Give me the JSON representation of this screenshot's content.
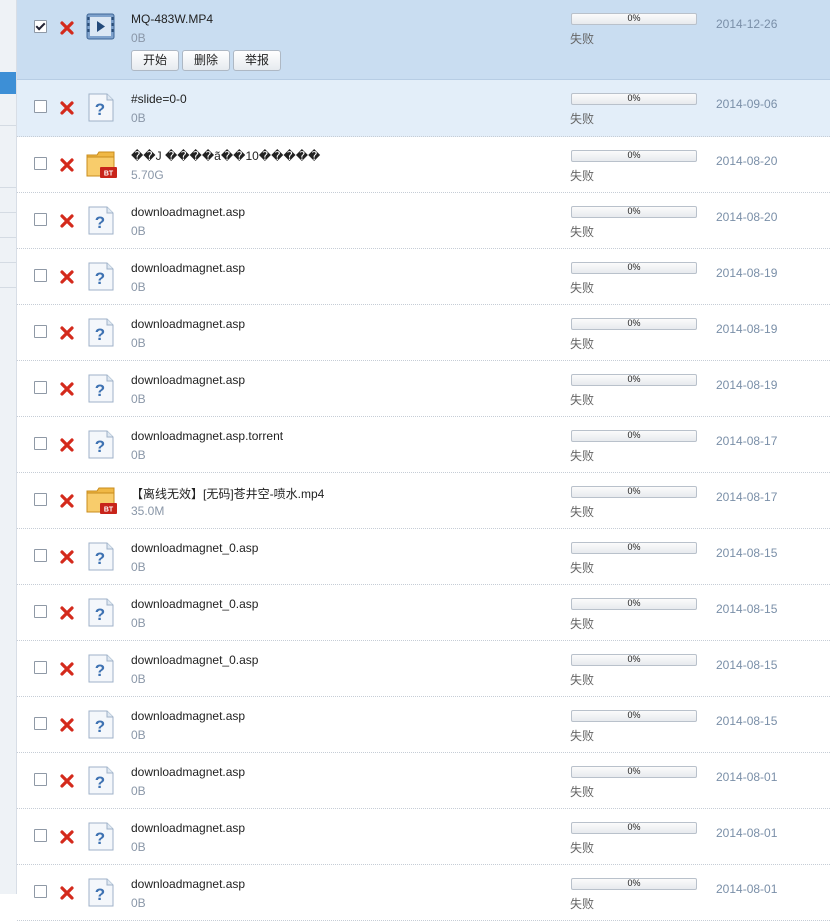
{
  "actions": {
    "start": "开始",
    "delete": "删除",
    "report": "举报"
  },
  "colors": {
    "progress_fill": "#6db33f",
    "selected_row": "#c9ddf1",
    "date_text": "#7a8fa8"
  },
  "rows": [
    {
      "name": "MQ-483W.MP4",
      "size": "0B",
      "progress": "0%",
      "status": "失败",
      "date": "2014-12-26",
      "icon": "video-file-icon",
      "checked": true,
      "expanded": true
    },
    {
      "name": "#slide=0-0",
      "size": "0B",
      "progress": "0%",
      "status": "失败",
      "date": "2014-09-06",
      "icon": "unknown-file-icon",
      "checked": false,
      "highlighted": true
    },
    {
      "name": "��J ����ã��10�����",
      "size": "5.70G",
      "progress": "0%",
      "status": "失败",
      "date": "2014-08-20",
      "icon": "bt-folder-icon",
      "checked": false
    },
    {
      "name": "downloadmagnet.asp",
      "size": "0B",
      "progress": "0%",
      "status": "失败",
      "date": "2014-08-20",
      "icon": "unknown-file-icon",
      "checked": false
    },
    {
      "name": "downloadmagnet.asp",
      "size": "0B",
      "progress": "0%",
      "status": "失败",
      "date": "2014-08-19",
      "icon": "unknown-file-icon",
      "checked": false
    },
    {
      "name": "downloadmagnet.asp",
      "size": "0B",
      "progress": "0%",
      "status": "失败",
      "date": "2014-08-19",
      "icon": "unknown-file-icon",
      "checked": false
    },
    {
      "name": "downloadmagnet.asp",
      "size": "0B",
      "progress": "0%",
      "status": "失败",
      "date": "2014-08-19",
      "icon": "unknown-file-icon",
      "checked": false
    },
    {
      "name": "downloadmagnet.asp.torrent",
      "size": "0B",
      "progress": "0%",
      "status": "失败",
      "date": "2014-08-17",
      "icon": "unknown-file-icon",
      "checked": false
    },
    {
      "name": "【离线无效】[无码]苍井空-喷水.mp4",
      "size": "35.0M",
      "progress": "0%",
      "status": "失败",
      "date": "2014-08-17",
      "icon": "bt-folder-icon",
      "checked": false
    },
    {
      "name": "downloadmagnet_0.asp",
      "size": "0B",
      "progress": "0%",
      "status": "失败",
      "date": "2014-08-15",
      "icon": "unknown-file-icon",
      "checked": false
    },
    {
      "name": "downloadmagnet_0.asp",
      "size": "0B",
      "progress": "0%",
      "status": "失败",
      "date": "2014-08-15",
      "icon": "unknown-file-icon",
      "checked": false
    },
    {
      "name": "downloadmagnet_0.asp",
      "size": "0B",
      "progress": "0%",
      "status": "失败",
      "date": "2014-08-15",
      "icon": "unknown-file-icon",
      "checked": false
    },
    {
      "name": "downloadmagnet.asp",
      "size": "0B",
      "progress": "0%",
      "status": "失败",
      "date": "2014-08-15",
      "icon": "unknown-file-icon",
      "checked": false
    },
    {
      "name": "downloadmagnet.asp",
      "size": "0B",
      "progress": "0%",
      "status": "失败",
      "date": "2014-08-01",
      "icon": "unknown-file-icon",
      "checked": false
    },
    {
      "name": "downloadmagnet.asp",
      "size": "0B",
      "progress": "0%",
      "status": "失败",
      "date": "2014-08-01",
      "icon": "unknown-file-icon",
      "checked": false
    },
    {
      "name": "downloadmagnet.asp",
      "size": "0B",
      "progress": "0%",
      "status": "失败",
      "date": "2014-08-01",
      "icon": "unknown-file-icon",
      "checked": false
    }
  ]
}
